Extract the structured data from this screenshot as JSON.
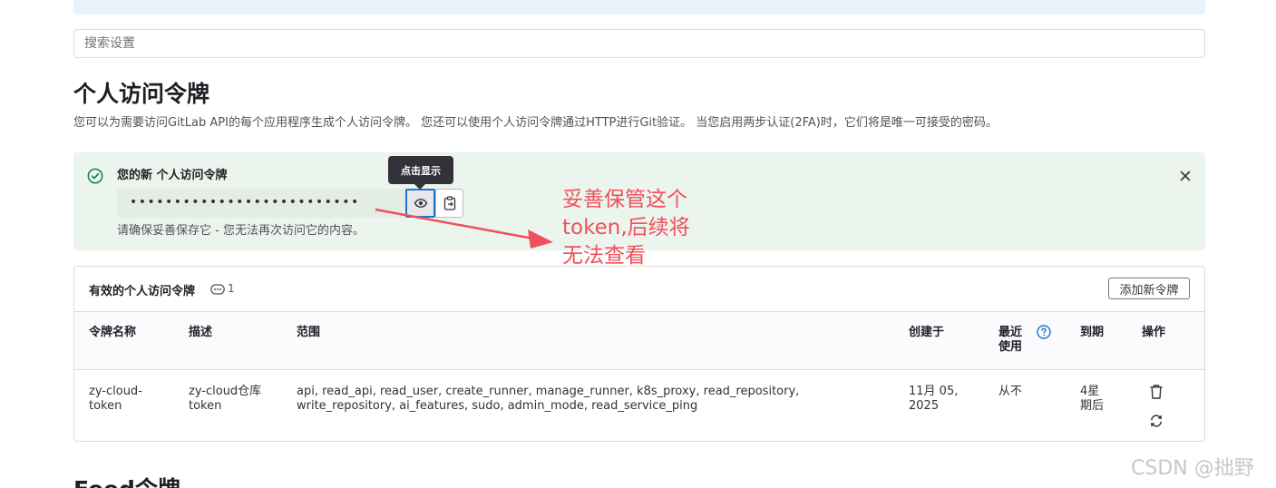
{
  "search": {
    "placeholder": "搜索设置"
  },
  "page": {
    "title": "个人访问令牌",
    "description": "您可以为需要访问GitLab API的每个应用程序生成个人访问令牌。 您还可以使用个人访问令牌通过HTTP进行Git验证。 当您启用两步认证(2FA)时，它们将是唯一可接受的密码。"
  },
  "alert": {
    "title": "您的新 个人访问令牌",
    "token_masked": "••••••••••••••••••••••••••",
    "note": "请确保妥善保存它 - 您无法再次访问它的内容。",
    "tooltip": "点击显示"
  },
  "annotation": {
    "lines": [
      "妥善保管这个",
      "token,后续将",
      "无法查看"
    ],
    "color": "#f0505a"
  },
  "tokens_card": {
    "title": "有效的个人访问令牌",
    "count": "1",
    "add_button": "添加新令牌",
    "columns": {
      "name": "令牌名称",
      "description": "描述",
      "scopes": "范围",
      "created": "创建于",
      "last_used": "最近使用",
      "expires": "到期",
      "actions": "操作"
    },
    "rows": [
      {
        "name": "zy-cloud-token",
        "description": "zy-cloud仓库token",
        "scopes": "api, read_api, read_user, create_runner, manage_runner, k8s_proxy, read_repository, write_repository, ai_features, sudo, admin_mode, read_service_ping",
        "created": "11月 05, 2025",
        "last_used": "从不",
        "expires": "4星期后"
      }
    ]
  },
  "feed": {
    "title": "Feed令牌"
  },
  "watermark": "CSDN @拙野",
  "colors": {
    "success": "#108548",
    "alert_bg": "#ecf4ee",
    "focus": "#1f75cb",
    "help": "#1f75cb"
  }
}
